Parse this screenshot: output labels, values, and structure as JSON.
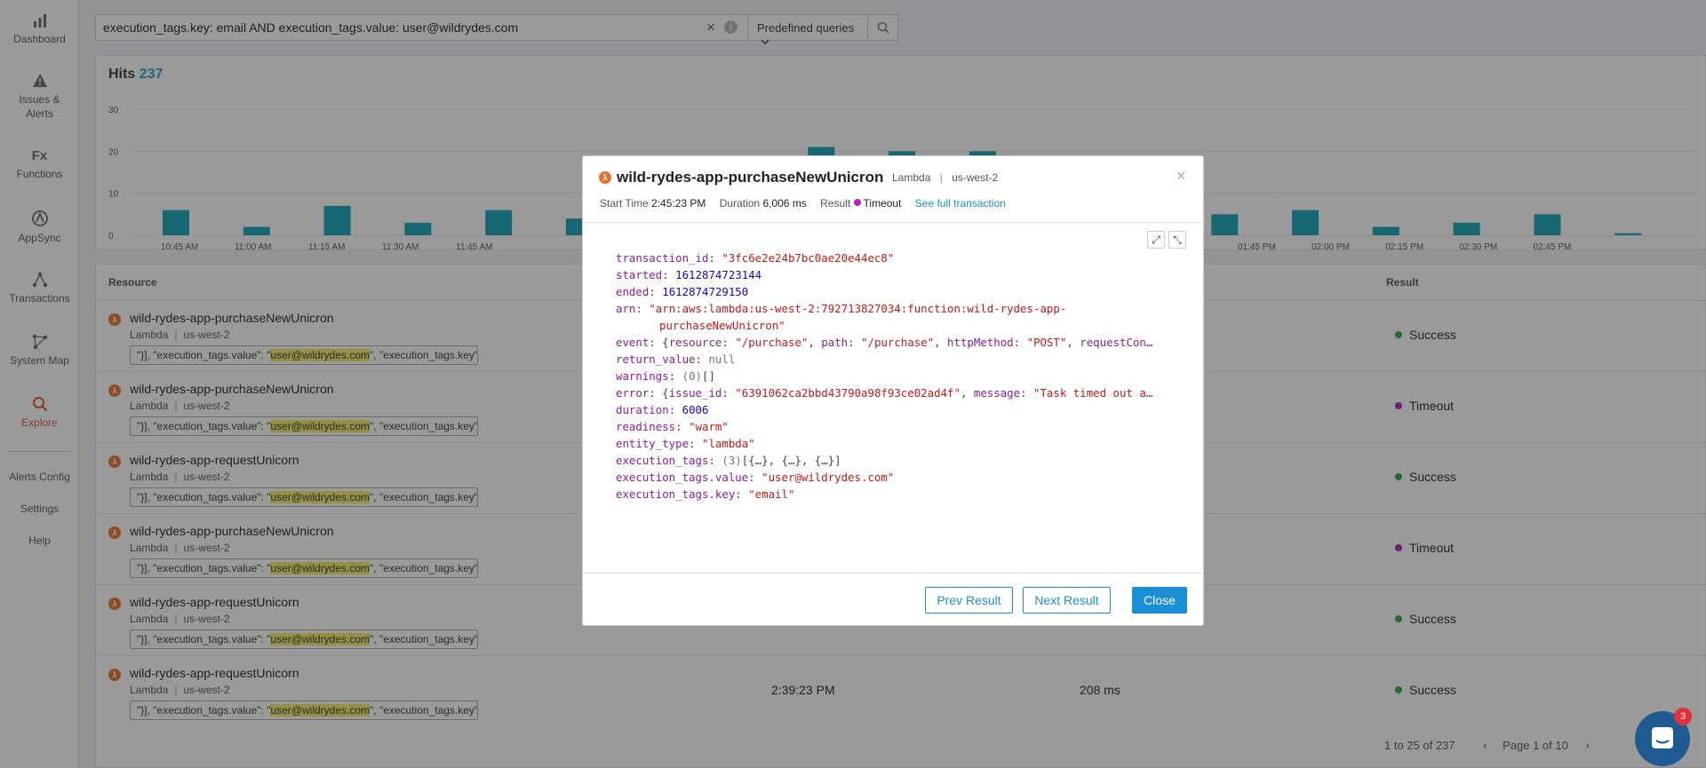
{
  "nav": {
    "items": [
      {
        "label": "Dashboard",
        "icon": "bar-chart-icon"
      },
      {
        "label": "Issues &",
        "label2": "Alerts",
        "icon": "warning-icon"
      },
      {
        "label": "Functions",
        "icon": "fx-icon"
      },
      {
        "label": "AppSync",
        "icon": "appsync-icon"
      },
      {
        "label": "Transactions",
        "icon": "transactions-icon"
      },
      {
        "label": "System Map",
        "icon": "system-map-icon"
      },
      {
        "label": "Explore",
        "icon": "search-icon"
      }
    ],
    "links": [
      "Alerts Config",
      "Settings",
      "Help"
    ]
  },
  "search": {
    "query": "execution_tags.key: email AND execution_tags.value: user@wildrydes.com",
    "predefined_label": "Predefined queries",
    "clear": "×",
    "info": "i"
  },
  "hits": {
    "label": "Hits",
    "count": "237"
  },
  "chart_data": {
    "type": "bar",
    "yticks": [
      "30",
      "20",
      "10",
      "0"
    ],
    "ylim": [
      0,
      30
    ],
    "xticks": [
      "10:45 AM",
      "11:00 AM",
      "11:15 AM",
      "11:30 AM",
      "11:45 AM",
      "01:45 PM",
      "02:00 PM",
      "02:15 PM",
      "02:30 PM",
      "02:45 PM"
    ],
    "values": [
      6,
      2,
      7,
      3,
      6,
      4,
      5,
      3,
      21,
      20,
      20,
      14,
      13,
      5,
      6,
      2,
      3,
      5,
      0.5
    ],
    "colors": {
      "bar": "#12a3b8"
    }
  },
  "table": {
    "headers": {
      "resource": "Resource",
      "result": "Result"
    },
    "rows": [
      {
        "name": "wild-rydes-app-purchaseNewUnicron",
        "type": "Lambda",
        "region": "us-west-2",
        "pre": "\"}], \"execution_tags.value\": \"",
        "hl": "user@wildrydes.com",
        "post": "\", \"execution_tags.key\"",
        "result": "Success",
        "time": "",
        "duration": ""
      },
      {
        "name": "wild-rydes-app-purchaseNewUnicron",
        "type": "Lambda",
        "region": "us-west-2",
        "pre": "\"}], \"execution_tags.value\": \"",
        "hl": "user@wildrydes.com",
        "post": "\", \"execution_tags.key\"",
        "result": "Timeout",
        "time": "",
        "duration": ""
      },
      {
        "name": "wild-rydes-app-requestUnicorn",
        "type": "Lambda",
        "region": "us-west-2",
        "pre": "\"}], \"execution_tags.value\": \"",
        "hl": "user@wildrydes.com",
        "post": "\", \"execution_tags.key\"",
        "result": "Success",
        "time": "",
        "duration": ""
      },
      {
        "name": "wild-rydes-app-purchaseNewUnicron",
        "type": "Lambda",
        "region": "us-west-2",
        "pre": "\"}], \"execution_tags.value\": \"",
        "hl": "user@wildrydes.com",
        "post": "\", \"execution_tags.key\"",
        "result": "Timeout",
        "time": "",
        "duration": ""
      },
      {
        "name": "wild-rydes-app-requestUnicorn",
        "type": "Lambda",
        "region": "us-west-2",
        "pre": "\"}], \"execution_tags.value\": \"",
        "hl": "user@wildrydes.com",
        "post": "\", \"execution_tags.key\"",
        "result": "Success",
        "time": "",
        "duration": ""
      },
      {
        "name": "wild-rydes-app-requestUnicorn",
        "type": "Lambda",
        "region": "us-west-2",
        "pre": "\"}], \"execution_tags.value\": \"",
        "hl": "user@wildrydes.com",
        "post": "\", \"execution_tags.key\"",
        "result": "Success",
        "time": "2:39:23 PM",
        "duration": "208 ms"
      }
    ],
    "pager": {
      "range": "1 to 25 of 237",
      "page": "Page 1 of 10"
    }
  },
  "modal": {
    "title": "wild-rydes-app-purchaseNewUnicron",
    "type": "Lambda",
    "region": "us-west-2",
    "start_label": "Start Time",
    "start": "2:45:23 PM",
    "duration_label": "Duration",
    "duration": "6,006 ms",
    "result_label": "Result",
    "result": "Timeout",
    "link": "See full transaction",
    "json": {
      "transaction_id": "\"3fc6e2e24b7bc0ae20e44ec8\"",
      "started": "1612874723144",
      "ended": "1612874729150",
      "arn1": "\"arn:aws:lambda:us-west-2:792713827034:function:wild-rydes-app-",
      "arn2": "purchaseNewUnicron\"",
      "event_resource": "\"/purchase\"",
      "event_path": "\"/purchase\"",
      "event_method": "\"POST\"",
      "event_tail": "requestCon…",
      "return_value": "null",
      "warnings_count": "(0)",
      "warnings": "[]",
      "error_issue": "\"6391062ca2bbd43790a98f93ce02ad4f\"",
      "error_msg": "\"Task timed out a…",
      "duration": "6006",
      "readiness": "\"warm\"",
      "entity_type": "\"lambda\"",
      "tags_count": "(3)",
      "tags": "[{…}, {…}, {…}]",
      "tag_value": "\"user@wildrydes.com\"",
      "tag_key": "\"email\""
    },
    "buttons": {
      "prev": "Prev Result",
      "next": "Next Result",
      "close": "Close"
    }
  },
  "chat": {
    "badge": "3"
  },
  "colors": {
    "accent": "#1a8fd6",
    "success": "#27a844",
    "timeout": "#b21fc4",
    "explore": "#e0522f"
  }
}
